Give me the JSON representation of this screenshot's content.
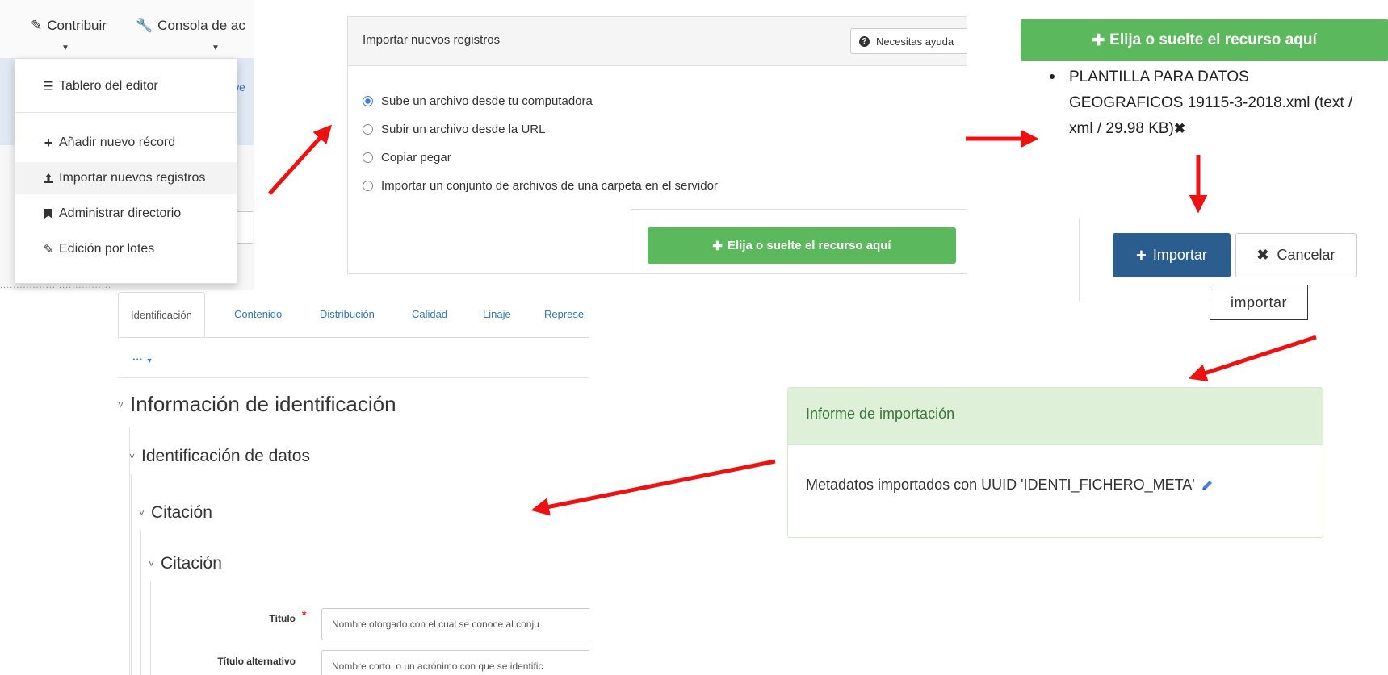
{
  "colors": {
    "arrow": "#ee1111",
    "success_green": "#5cb85c",
    "primary_blue": "#2b5d8f",
    "report_bg": "#dff0d8",
    "report_text": "#3c763d",
    "link_blue": "#337ab7"
  },
  "menu": {
    "nav": [
      {
        "label": "Contribuir",
        "icon": "pencil-icon"
      },
      {
        "label": "Consola de ac",
        "icon": "wrench-icon"
      }
    ],
    "background_text": "we",
    "background_text2": "..................................",
    "items": [
      {
        "label": "Tablero del editor",
        "icon": "list-icon"
      },
      {
        "label": "Añadir nuevo récord",
        "icon": "plus-icon"
      },
      {
        "label": "Importar nuevos registros",
        "icon": "upload-icon"
      },
      {
        "label": "Administrar directorio",
        "icon": "bookmark-icon"
      },
      {
        "label": "Edición por lotes",
        "icon": "pencil-icon"
      }
    ]
  },
  "import": {
    "title": "Importar nuevos registros",
    "help": "Necesitas ayuda",
    "options": [
      {
        "label": "Sube un archivo desde tu computadora",
        "selected": true
      },
      {
        "label": "Subir un archivo desde la URL",
        "selected": false
      },
      {
        "label": "Copiar pegar",
        "selected": false
      },
      {
        "label": "Importar un conjunto de archivos de una carpeta en el servidor",
        "selected": false
      }
    ],
    "drop_button": "Elija o suelte el recurso aquí"
  },
  "upload": {
    "drop_button": "Elija o suelte el recurso aquí",
    "file_line1": "PLANTILLA PARA DATOS",
    "file_line2": "GEOGRAFICOS 19115-3-2018.xml (text /",
    "file_line3": "xml / 29.98 KB)",
    "remove_glyph": "✖",
    "import_button": "Importar",
    "cancel_button": "Cancelar",
    "tooltip": "importar"
  },
  "report": {
    "title": "Informe de importación",
    "message": "Metadatos importados con UUID 'IDENTI_FICHERO_META'"
  },
  "editor": {
    "tabs": [
      "Identificación",
      "Contenido",
      "Distribución",
      "Calidad",
      "Linaje",
      "Represe"
    ],
    "more": "···",
    "sections": {
      "identification_info": "Información de identificación",
      "data_identification": "Identificación de datos",
      "citation_outer": "Citación",
      "citation_inner": "Citación"
    },
    "fields": [
      {
        "label": "Título",
        "required": "*",
        "placeholder": "Nombre otorgado con el cual se conoce al conju"
      },
      {
        "label": "Título alternativo",
        "placeholder": "Nombre corto, o un acrónimo con que se identific"
      }
    ]
  }
}
